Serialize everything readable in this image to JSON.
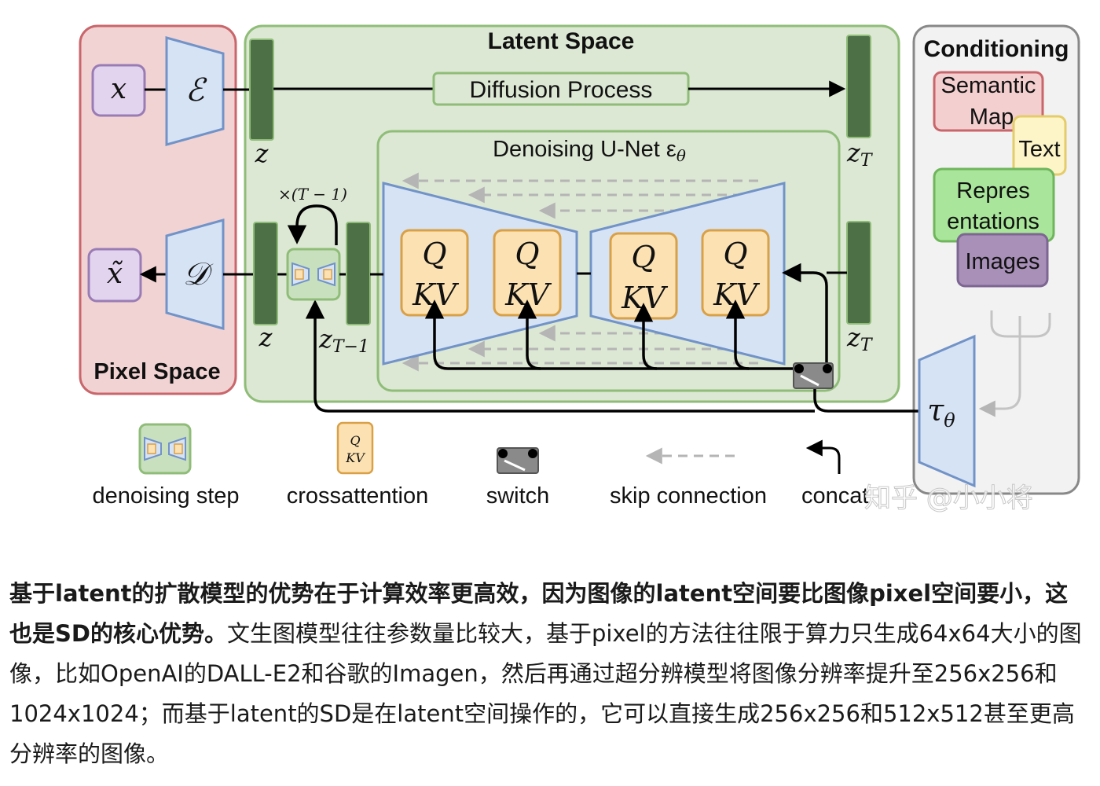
{
  "diagram": {
    "latent_space_title": "Latent Space",
    "pixel_space_title": "Pixel Space",
    "conditioning_title": "Conditioning",
    "diffusion_process_label": "Diffusion Process",
    "unet_label": "Denoising U-Net ε",
    "unet_label_sub": "θ",
    "symbols": {
      "x": "x",
      "x_tilde": "x̃",
      "encoder": "ℰ",
      "decoder": "𝒟",
      "z": "z",
      "z_T": "z",
      "z_T_sub": "T",
      "z_T_minus_1": "z",
      "z_T_minus_1_sub": "T−1",
      "repeat": "×(T − 1)",
      "tau": "τ",
      "tau_sub": "θ"
    },
    "cross_attention_blocks": [
      {
        "q": "Q",
        "kv": "KV"
      },
      {
        "q": "Q",
        "kv": "KV"
      },
      {
        "q": "Q",
        "kv": "KV"
      },
      {
        "q": "Q",
        "kv": "KV"
      }
    ],
    "conditioning_items": {
      "semantic_map": [
        "Semantic",
        "Map"
      ],
      "text": "Text",
      "representations": [
        "Repres",
        "entations"
      ],
      "images": "Images"
    },
    "legend": {
      "denoising_step": "denoising step",
      "crossattention": "crossattention",
      "switch": "switch",
      "skip_connection": "skip connection",
      "concat": "concat"
    },
    "legend_qkv": {
      "q": "Q",
      "kv": "KV"
    },
    "watermark": "知乎 @小小将",
    "colors": {
      "pixel_space_fill": "#f2d3d3",
      "pixel_space_stroke": "#c9666b",
      "latent_fill": "#dce8d4",
      "latent_stroke": "#8fbd78",
      "dark_green": "#4d7047",
      "trapezoid_fill": "#d6e3f5",
      "trapezoid_stroke": "#7193c7",
      "qkv_fill": "#fce2b3",
      "qkv_stroke": "#d9a046",
      "conditioning_fill": "#f2f2f2",
      "input_purple": "#e2d4ee",
      "input_purple_stroke": "#9a7cb5",
      "repr_green": "#a9e59a",
      "images_purple": "#a890b8",
      "text_yellow": "#fdf5c8"
    }
  },
  "caption": {
    "bold_part": "基于latent的扩散模型的优势在于计算效率更高效，因为图像的latent空间要比图像pixel空间要小，这也是SD的核心优势。",
    "normal_part": "文生图模型往往参数量比较大，基于pixel的方法往往限于算力只生成64x64大小的图像，比如OpenAI的DALL-E2和谷歌的Imagen，然后再通过超分辨模型将图像分辨率提升至256x256和1024x1024；而基于latent的SD是在latent空间操作的，它可以直接生成256x256和512x512甚至更高分辨率的图像。"
  }
}
